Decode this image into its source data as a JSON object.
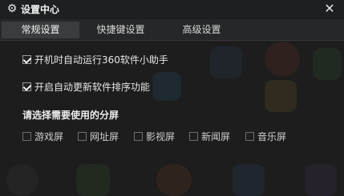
{
  "titlebar": {
    "title": "设置中心",
    "gear_icon": "gear-icon",
    "close_icon": "close-icon",
    "close_glyph": "✕"
  },
  "tabs": [
    {
      "label": "常规设置",
      "active": true
    },
    {
      "label": "快捷键设置",
      "active": false
    },
    {
      "label": "高级设置",
      "active": false
    }
  ],
  "options": [
    {
      "label": "开机时自动运行360软件小助手",
      "checked": true
    },
    {
      "label": "开启自动更新软件排序功能",
      "checked": true
    }
  ],
  "screens": {
    "title": "请选择需要使用的分屏",
    "items": [
      {
        "label": "游戏屏",
        "checked": false
      },
      {
        "label": "网址屏",
        "checked": false
      },
      {
        "label": "影视屏",
        "checked": false
      },
      {
        "label": "新闻屏",
        "checked": false
      },
      {
        "label": "音乐屏",
        "checked": false
      }
    ]
  },
  "colors": {
    "background": "#1d1d1e",
    "tab_active": "#3b3c3d",
    "text": "#e6e6e6"
  }
}
